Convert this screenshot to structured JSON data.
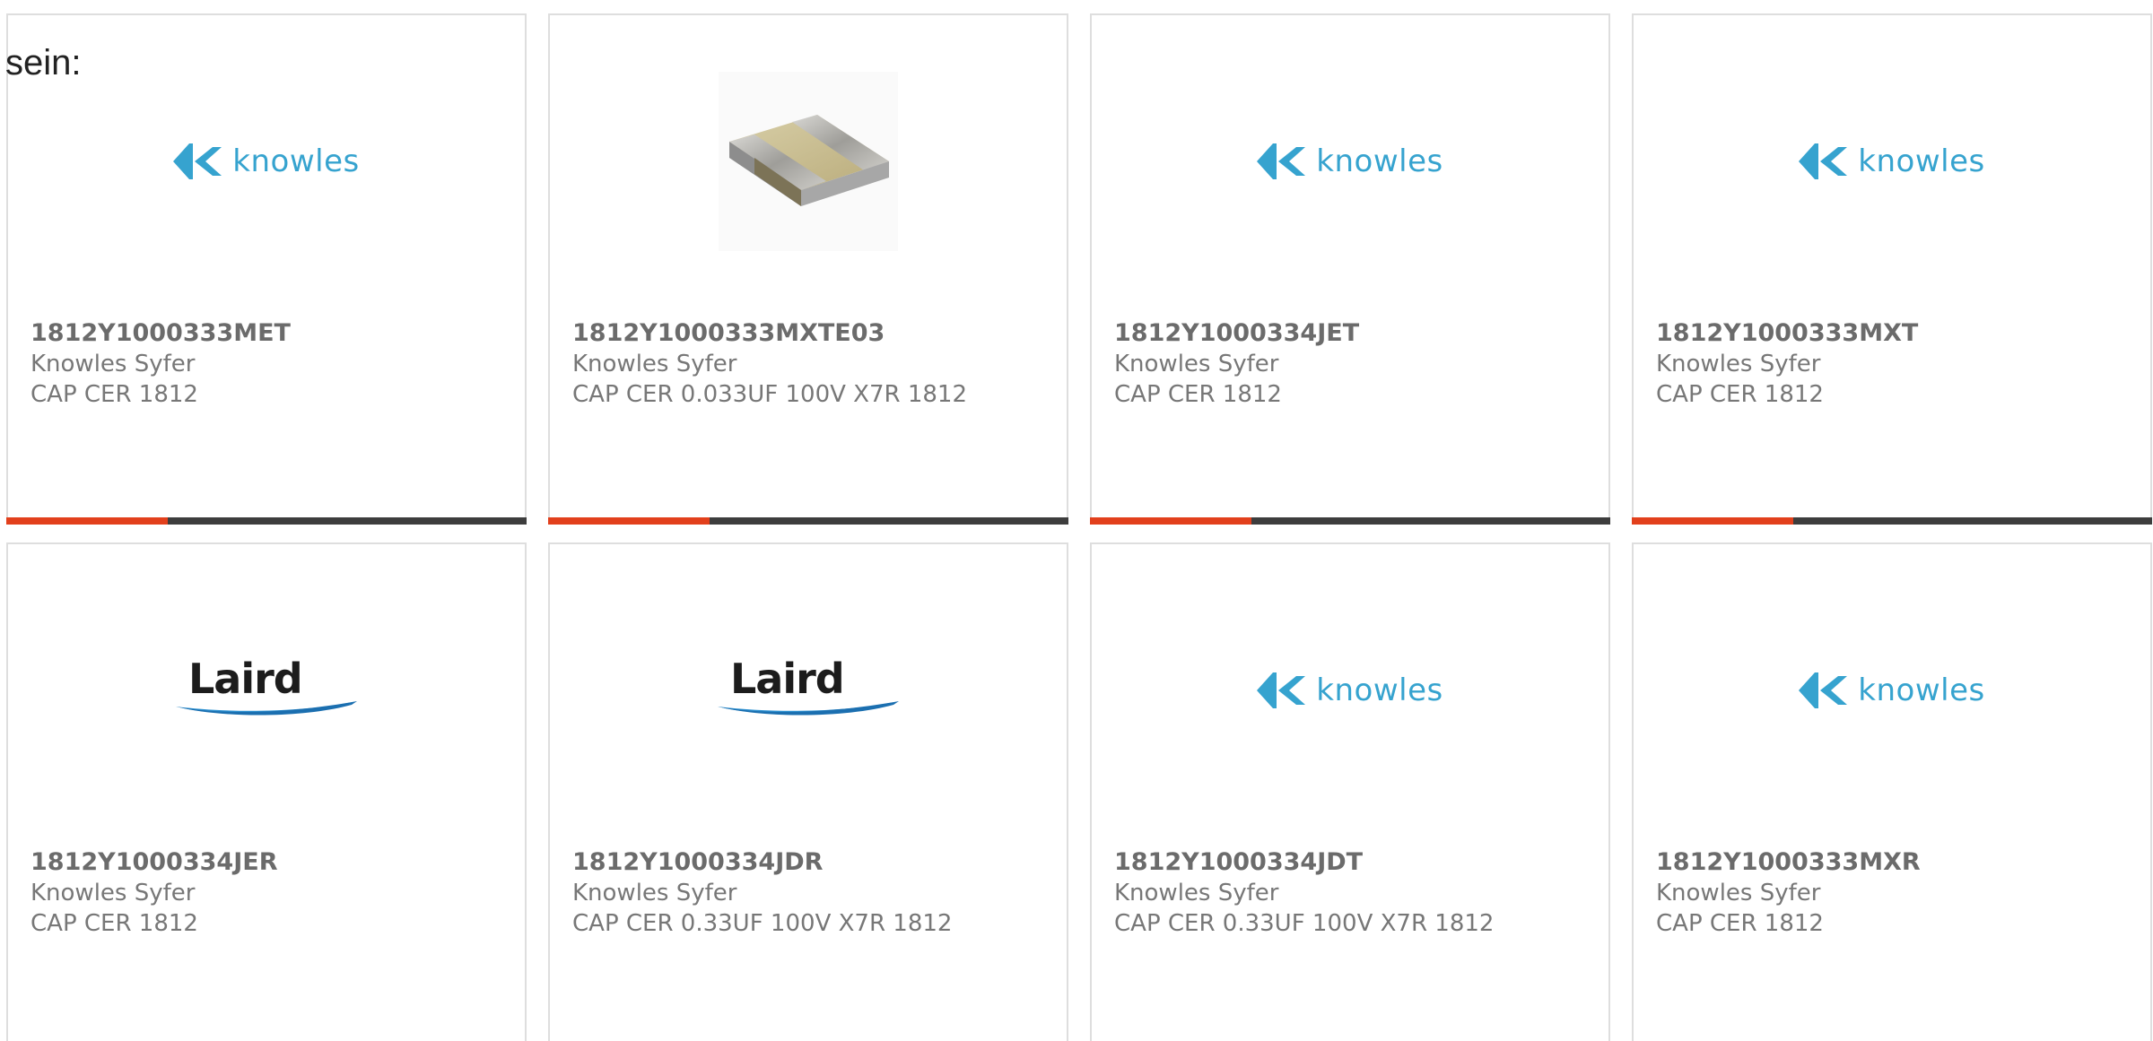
{
  "intro": "sein:",
  "colors": {
    "accent": "#e2401c",
    "bar_track": "#3d3d3d",
    "knowles_blue": "#36a3cf",
    "border": "#dedede"
  },
  "cards": [
    {
      "part_number": "1812Y1000333MET",
      "manufacturer": "Knowles Syfer",
      "description": "CAP CER 1812",
      "image": "knowles-logo",
      "logo_text": "knowles",
      "progress": 0.31
    },
    {
      "part_number": "1812Y1000333MXTE03",
      "manufacturer": "Knowles Syfer",
      "description": "CAP CER 0.033UF 100V X7R 1812",
      "image": "capacitor-chip-image",
      "progress": 0.31
    },
    {
      "part_number": "1812Y1000334JET",
      "manufacturer": "Knowles Syfer",
      "description": "CAP CER 1812",
      "image": "knowles-logo",
      "logo_text": "knowles",
      "progress": 0.31
    },
    {
      "part_number": "1812Y1000333MXT",
      "manufacturer": "Knowles Syfer",
      "description": "CAP CER 1812",
      "image": "knowles-logo",
      "logo_text": "knowles",
      "progress": 0.31
    },
    {
      "part_number": "1812Y1000334JER",
      "manufacturer": "Knowles Syfer",
      "description": "CAP CER 1812",
      "image": "laird-logo",
      "logo_text": "Laird"
    },
    {
      "part_number": "1812Y1000334JDR",
      "manufacturer": "Knowles Syfer",
      "description": "CAP CER 0.33UF 100V X7R 1812",
      "image": "laird-logo",
      "logo_text": "Laird"
    },
    {
      "part_number": "1812Y1000334JDT",
      "manufacturer": "Knowles Syfer",
      "description": "CAP CER 0.33UF 100V X7R 1812",
      "image": "knowles-logo",
      "logo_text": "knowles"
    },
    {
      "part_number": "1812Y1000333MXR",
      "manufacturer": "Knowles Syfer",
      "description": "CAP CER 1812",
      "image": "knowles-logo",
      "logo_text": "knowles"
    }
  ]
}
